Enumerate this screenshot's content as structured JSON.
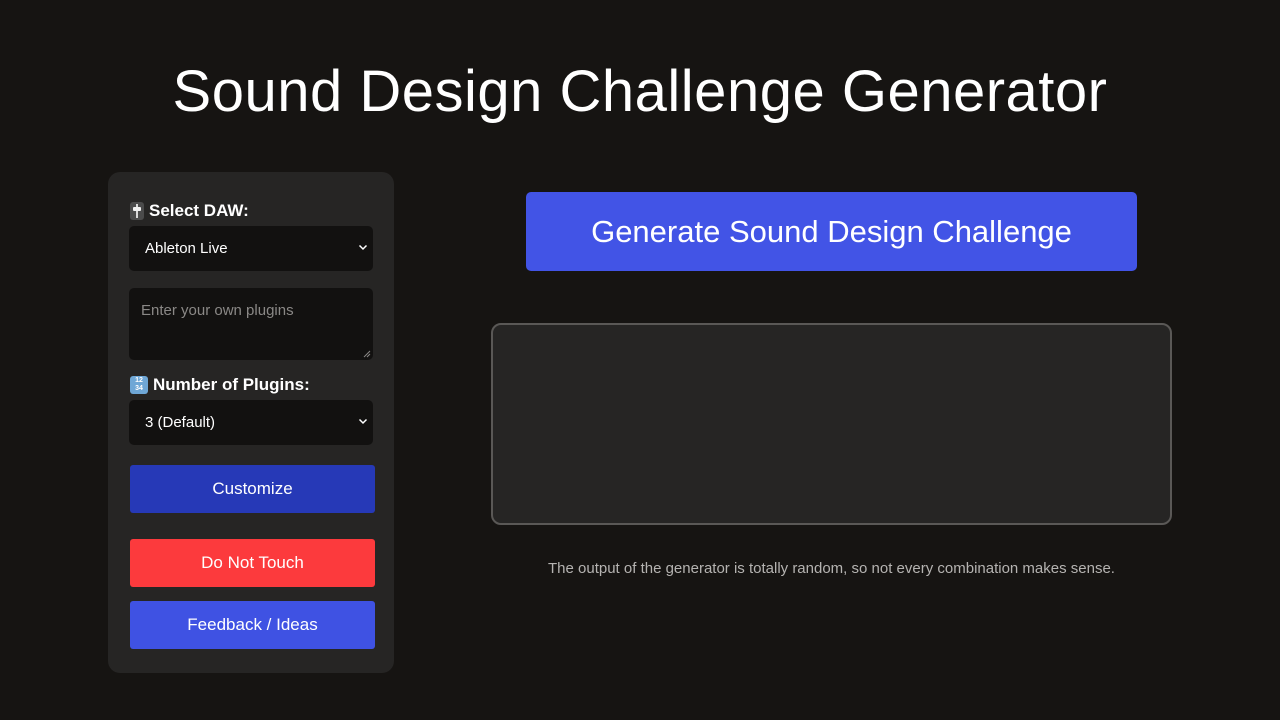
{
  "header": {
    "title": "Sound Design Challenge Generator"
  },
  "sidebar": {
    "daw_label": "Select DAW:",
    "daw_icon": "fader-icon",
    "daw_selected": "Ableton Live",
    "plugins_placeholder": "Enter your own plugins",
    "count_label": "Number of Plugins:",
    "count_icon": "numbers-1234-icon",
    "count_icon_text": "12\n34",
    "count_selected": "3 (Default)",
    "customize_label": "Customize",
    "do_not_touch_label": "Do Not Touch",
    "feedback_label": "Feedback / Ideas"
  },
  "main": {
    "generate_label": "Generate Sound Design Challenge",
    "output_text": "",
    "disclaimer": "The output of the generator is totally random, so not every combination makes sense."
  },
  "colors": {
    "background": "#161412",
    "panel": "#262524",
    "input_bg": "#121110",
    "customize": "#2639b7",
    "do_not_touch": "#fc3a3d",
    "feedback": "#3f52e3",
    "generate": "#4254e6"
  }
}
